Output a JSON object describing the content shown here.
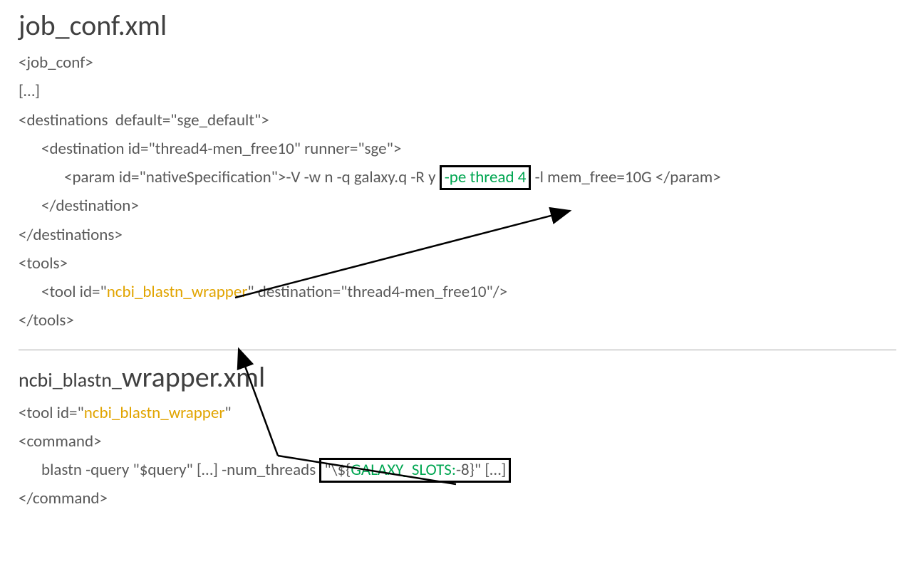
{
  "section1": {
    "title": "job_conf.xml",
    "l1": "<job_conf>",
    "l2": "[…]",
    "l3": "<destinations  default=\"sge_default\">",
    "l4a": "<destination id=\"thread4-men_free10\" runner=\"sge\">",
    "l5a": "<param id=\"nativeSpecification\">-V -w n -q galaxy.q -R y ",
    "l5_box": "-pe thread 4",
    "l5b": " -l mem_free=10G </param>",
    "l6": "</destination>",
    "l7": "</destinations>",
    "l8": "<tools>",
    "l9a": "<tool id=\"",
    "l9_orange": "ncbi_blastn_wrapper",
    "l9b": "\" destination=\"thread4-men_free10\"/>",
    "l10": "</tools>"
  },
  "section2": {
    "title_small": "ncbi_blastn_",
    "title_big": "wrapper.xml",
    "l1a": "<tool id=\"",
    "l1_orange": "ncbi_blastn_wrapper",
    "l1b": "\"",
    "l2": "<command>",
    "l3a": "blastn -query \"$query\" […] -num_threads ",
    "l3_box_a": "\"\\${",
    "l3_box_green": "GALAXY_SLOTS:",
    "l3_box_b": "-8}\" […]",
    "l3_after": "",
    "l4": "</command>"
  }
}
